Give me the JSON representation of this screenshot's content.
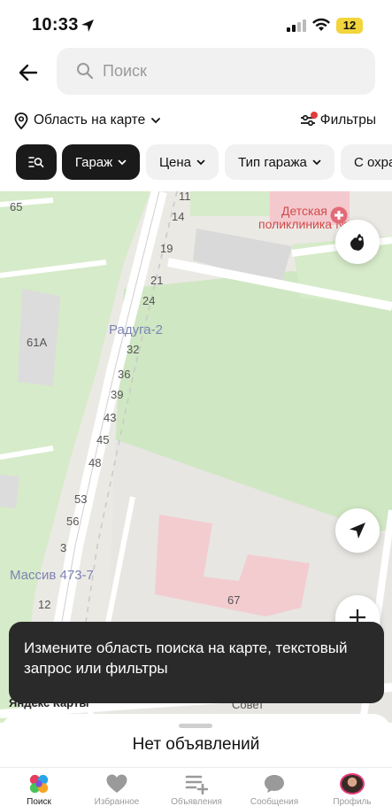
{
  "status_bar": {
    "time": "10:33",
    "battery": "12"
  },
  "search": {
    "placeholder": "Поиск"
  },
  "filter_row": {
    "area_label": "Область на карте",
    "filters_label": "Фильтры"
  },
  "chips": [
    {
      "label": "Гараж"
    },
    {
      "label": "Цена"
    },
    {
      "label": "Тип гаража"
    },
    {
      "label": "С охра"
    }
  ],
  "map": {
    "labels": {
      "n65": "65",
      "n11": "11",
      "n14": "14",
      "n19": "19",
      "n21": "21",
      "n24": "24",
      "n32": "32",
      "n36": "36",
      "n39": "39",
      "n43": "43",
      "n45": "45",
      "n48": "48",
      "n53": "53",
      "n56": "56",
      "n3": "3",
      "n12": "12",
      "n61a": "61А",
      "n67": "67",
      "raduga": "Радуга-2",
      "massiv": "Массив 473-7",
      "clinic_line1": "Детская",
      "clinic_line2": "поликлиника № 1",
      "street": "Совет",
      "provider": "Яндекс Карты"
    }
  },
  "toast": {
    "text": "Измените область поиска на карте, текстовый запрос или фильтры"
  },
  "sheet": {
    "title": "Нет объявлений"
  },
  "tabs": [
    {
      "label": "Поиск",
      "icon": "search-dots-icon",
      "active": true
    },
    {
      "label": "Избранное",
      "icon": "heart-icon",
      "active": false
    },
    {
      "label": "Объявления",
      "icon": "add-listing-icon",
      "active": false
    },
    {
      "label": "Сообщения",
      "icon": "chat-icon",
      "active": false
    },
    {
      "label": "Профиль",
      "icon": "avatar",
      "active": false
    }
  ],
  "colors": {
    "accent_dark": "#1a1a1a",
    "map_green": "#cfe7c3",
    "map_building": "#dcdcdc",
    "hospital_pink": "#f4c9ce"
  }
}
